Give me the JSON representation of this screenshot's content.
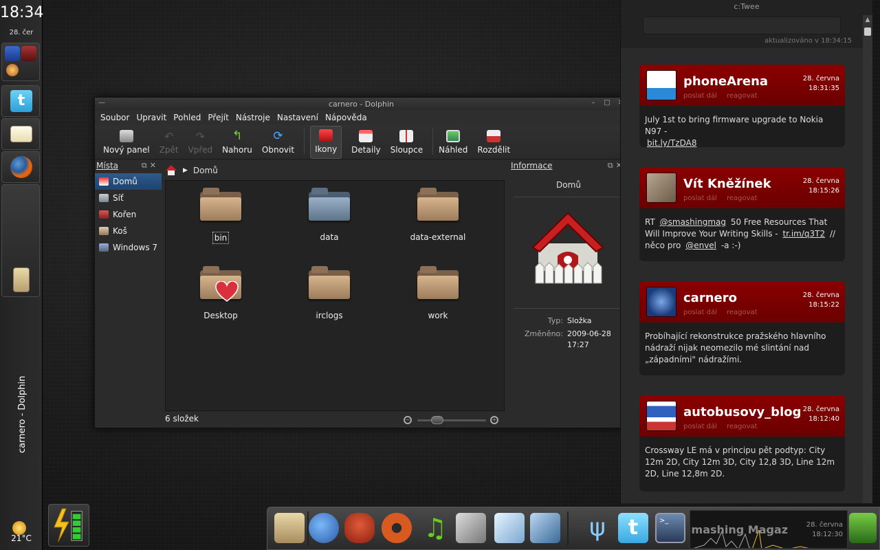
{
  "clock": {
    "time": "18:34",
    "date": "28. čer"
  },
  "weather": {
    "temp": "21°C"
  },
  "taskbar": {
    "active_task": "carnero - Dolphin"
  },
  "dolphin": {
    "title": "carnero - Dolphin",
    "menu": [
      "Soubor",
      "Upravit",
      "Pohled",
      "Přejít",
      "Nástroje",
      "Nastavení",
      "Nápověda"
    ],
    "toolbar": {
      "new_panel": "Nový panel",
      "back": "Zpět",
      "forward": "Vpřed",
      "up": "Nahoru",
      "reload": "Obnovit",
      "icons": "Ikony",
      "details": "Detaily",
      "columns": "Sloupce",
      "preview": "Náhled",
      "split": "Rozdělit"
    },
    "places": {
      "title": "Místa",
      "items": [
        "Domů",
        "Síť",
        "Kořen",
        "Koš",
        "Windows 7"
      ]
    },
    "breadcrumb": "Domů",
    "files": [
      "bin",
      "data",
      "data-external",
      "Desktop",
      "irclogs",
      "work"
    ],
    "status": "6 složek",
    "info": {
      "title": "Informace",
      "name": "Domů",
      "type_label": "Typ:",
      "type_value": "Složka",
      "modified_label": "Změněno:",
      "modified_date": "2009-06-28",
      "modified_time": "17:27"
    }
  },
  "twitter": {
    "title": "c:Twee",
    "updated": "aktualizováno v 18:34:15",
    "actions": [
      "poslat dál",
      "reagovat"
    ],
    "tweets": [
      {
        "name": "phoneArena",
        "date": "28. června",
        "time": "18:31:35",
        "text": "July 1st to bring firmware upgrade to Nokia N97 -",
        "link": "bit.ly/TzDA8"
      },
      {
        "name": "Vít Kněžínek",
        "date": "28. června",
        "time": "18:15:26",
        "text_a": "RT",
        "mention": "@smashingmag",
        "text_b": "50 Free Resources That Will Improve Your Writing Skills -",
        "link": "tr.im/q3T2",
        "text_c": "// něco pro",
        "mention2": "@envel",
        "text_d": "-a :-)"
      },
      {
        "name": "carnero",
        "date": "28. června",
        "time": "18:15:22",
        "text": "Probíhající rekonstrukce pražského hlavního nádraží nijak neomezilo mé slintání nad „západními\" nádražími."
      },
      {
        "name": "autobusovy_blog",
        "date": "28. června",
        "time": "18:12:40",
        "text": "Crossway LE má v principu pět podtyp: City 12m 2D, City 12m 3D, City 12,8 3D, Line 12m 2D, Line 12,8m 2D."
      }
    ]
  },
  "dock": {
    "feed_title": "Smashing Magaz",
    "feed_date": "28. června",
    "feed_time": "18:12:30"
  },
  "colors": {
    "accent_red": "#8b0000",
    "selection_blue": "#2f5a8a"
  }
}
